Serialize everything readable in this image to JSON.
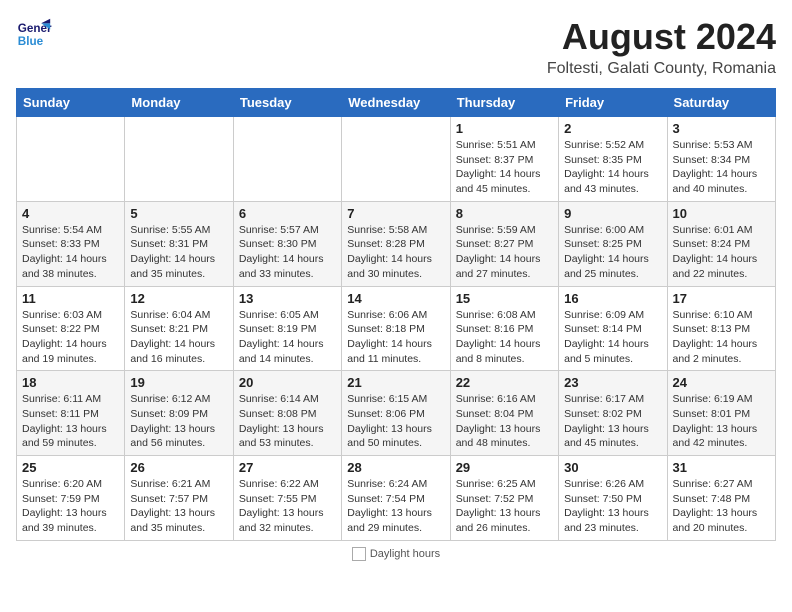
{
  "header": {
    "logo_line1": "General",
    "logo_line2": "Blue",
    "main_title": "August 2024",
    "subtitle": "Foltesti, Galati County, Romania"
  },
  "days_of_week": [
    "Sunday",
    "Monday",
    "Tuesday",
    "Wednesday",
    "Thursday",
    "Friday",
    "Saturday"
  ],
  "weeks": [
    [
      {
        "day": "",
        "info": ""
      },
      {
        "day": "",
        "info": ""
      },
      {
        "day": "",
        "info": ""
      },
      {
        "day": "",
        "info": ""
      },
      {
        "day": "1",
        "info": "Sunrise: 5:51 AM\nSunset: 8:37 PM\nDaylight: 14 hours\nand 45 minutes."
      },
      {
        "day": "2",
        "info": "Sunrise: 5:52 AM\nSunset: 8:35 PM\nDaylight: 14 hours\nand 43 minutes."
      },
      {
        "day": "3",
        "info": "Sunrise: 5:53 AM\nSunset: 8:34 PM\nDaylight: 14 hours\nand 40 minutes."
      }
    ],
    [
      {
        "day": "4",
        "info": "Sunrise: 5:54 AM\nSunset: 8:33 PM\nDaylight: 14 hours\nand 38 minutes."
      },
      {
        "day": "5",
        "info": "Sunrise: 5:55 AM\nSunset: 8:31 PM\nDaylight: 14 hours\nand 35 minutes."
      },
      {
        "day": "6",
        "info": "Sunrise: 5:57 AM\nSunset: 8:30 PM\nDaylight: 14 hours\nand 33 minutes."
      },
      {
        "day": "7",
        "info": "Sunrise: 5:58 AM\nSunset: 8:28 PM\nDaylight: 14 hours\nand 30 minutes."
      },
      {
        "day": "8",
        "info": "Sunrise: 5:59 AM\nSunset: 8:27 PM\nDaylight: 14 hours\nand 27 minutes."
      },
      {
        "day": "9",
        "info": "Sunrise: 6:00 AM\nSunset: 8:25 PM\nDaylight: 14 hours\nand 25 minutes."
      },
      {
        "day": "10",
        "info": "Sunrise: 6:01 AM\nSunset: 8:24 PM\nDaylight: 14 hours\nand 22 minutes."
      }
    ],
    [
      {
        "day": "11",
        "info": "Sunrise: 6:03 AM\nSunset: 8:22 PM\nDaylight: 14 hours\nand 19 minutes."
      },
      {
        "day": "12",
        "info": "Sunrise: 6:04 AM\nSunset: 8:21 PM\nDaylight: 14 hours\nand 16 minutes."
      },
      {
        "day": "13",
        "info": "Sunrise: 6:05 AM\nSunset: 8:19 PM\nDaylight: 14 hours\nand 14 minutes."
      },
      {
        "day": "14",
        "info": "Sunrise: 6:06 AM\nSunset: 8:18 PM\nDaylight: 14 hours\nand 11 minutes."
      },
      {
        "day": "15",
        "info": "Sunrise: 6:08 AM\nSunset: 8:16 PM\nDaylight: 14 hours\nand 8 minutes."
      },
      {
        "day": "16",
        "info": "Sunrise: 6:09 AM\nSunset: 8:14 PM\nDaylight: 14 hours\nand 5 minutes."
      },
      {
        "day": "17",
        "info": "Sunrise: 6:10 AM\nSunset: 8:13 PM\nDaylight: 14 hours\nand 2 minutes."
      }
    ],
    [
      {
        "day": "18",
        "info": "Sunrise: 6:11 AM\nSunset: 8:11 PM\nDaylight: 13 hours\nand 59 minutes."
      },
      {
        "day": "19",
        "info": "Sunrise: 6:12 AM\nSunset: 8:09 PM\nDaylight: 13 hours\nand 56 minutes."
      },
      {
        "day": "20",
        "info": "Sunrise: 6:14 AM\nSunset: 8:08 PM\nDaylight: 13 hours\nand 53 minutes."
      },
      {
        "day": "21",
        "info": "Sunrise: 6:15 AM\nSunset: 8:06 PM\nDaylight: 13 hours\nand 50 minutes."
      },
      {
        "day": "22",
        "info": "Sunrise: 6:16 AM\nSunset: 8:04 PM\nDaylight: 13 hours\nand 48 minutes."
      },
      {
        "day": "23",
        "info": "Sunrise: 6:17 AM\nSunset: 8:02 PM\nDaylight: 13 hours\nand 45 minutes."
      },
      {
        "day": "24",
        "info": "Sunrise: 6:19 AM\nSunset: 8:01 PM\nDaylight: 13 hours\nand 42 minutes."
      }
    ],
    [
      {
        "day": "25",
        "info": "Sunrise: 6:20 AM\nSunset: 7:59 PM\nDaylight: 13 hours\nand 39 minutes."
      },
      {
        "day": "26",
        "info": "Sunrise: 6:21 AM\nSunset: 7:57 PM\nDaylight: 13 hours\nand 35 minutes."
      },
      {
        "day": "27",
        "info": "Sunrise: 6:22 AM\nSunset: 7:55 PM\nDaylight: 13 hours\nand 32 minutes."
      },
      {
        "day": "28",
        "info": "Sunrise: 6:24 AM\nSunset: 7:54 PM\nDaylight: 13 hours\nand 29 minutes."
      },
      {
        "day": "29",
        "info": "Sunrise: 6:25 AM\nSunset: 7:52 PM\nDaylight: 13 hours\nand 26 minutes."
      },
      {
        "day": "30",
        "info": "Sunrise: 6:26 AM\nSunset: 7:50 PM\nDaylight: 13 hours\nand 23 minutes."
      },
      {
        "day": "31",
        "info": "Sunrise: 6:27 AM\nSunset: 7:48 PM\nDaylight: 13 hours\nand 20 minutes."
      }
    ]
  ],
  "footer": {
    "daylight_label": "Daylight hours"
  }
}
